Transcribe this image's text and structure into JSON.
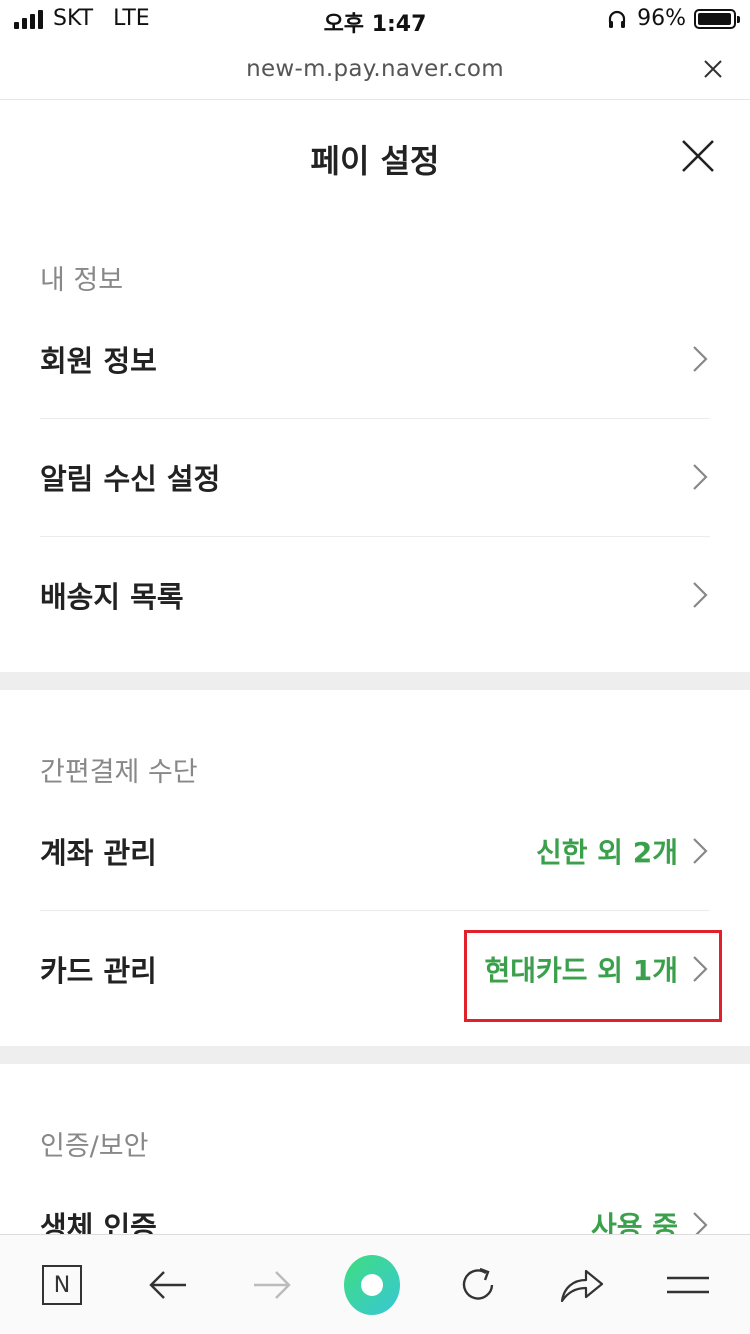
{
  "status_bar": {
    "carrier": "SKT",
    "network": "LTE",
    "time": "오후 1:47",
    "battery": "96%",
    "battery_level": 0.96
  },
  "browser": {
    "url": "new-m.pay.naver.com"
  },
  "header": {
    "title": "페이 설정"
  },
  "sections": [
    {
      "title": "내 정보",
      "items": [
        {
          "label": "회원 정보",
          "value": ""
        },
        {
          "label": "알림 수신 설정",
          "value": ""
        },
        {
          "label": "배송지 목록",
          "value": ""
        }
      ]
    },
    {
      "title": "간편결제 수단",
      "items": [
        {
          "label": "계좌 관리",
          "value": "신한 외 2개"
        },
        {
          "label": "카드 관리",
          "value": "현대카드 외 1개"
        }
      ]
    },
    {
      "title": "인증/보안",
      "items": [
        {
          "label": "생체 인증",
          "value": "사용 중"
        }
      ]
    }
  ],
  "toolbar": {
    "naver_label": "N"
  },
  "colors": {
    "accent_green": "#3aa04b",
    "highlight_red": "#e0202a",
    "divider_gray": "#eeeeee"
  }
}
